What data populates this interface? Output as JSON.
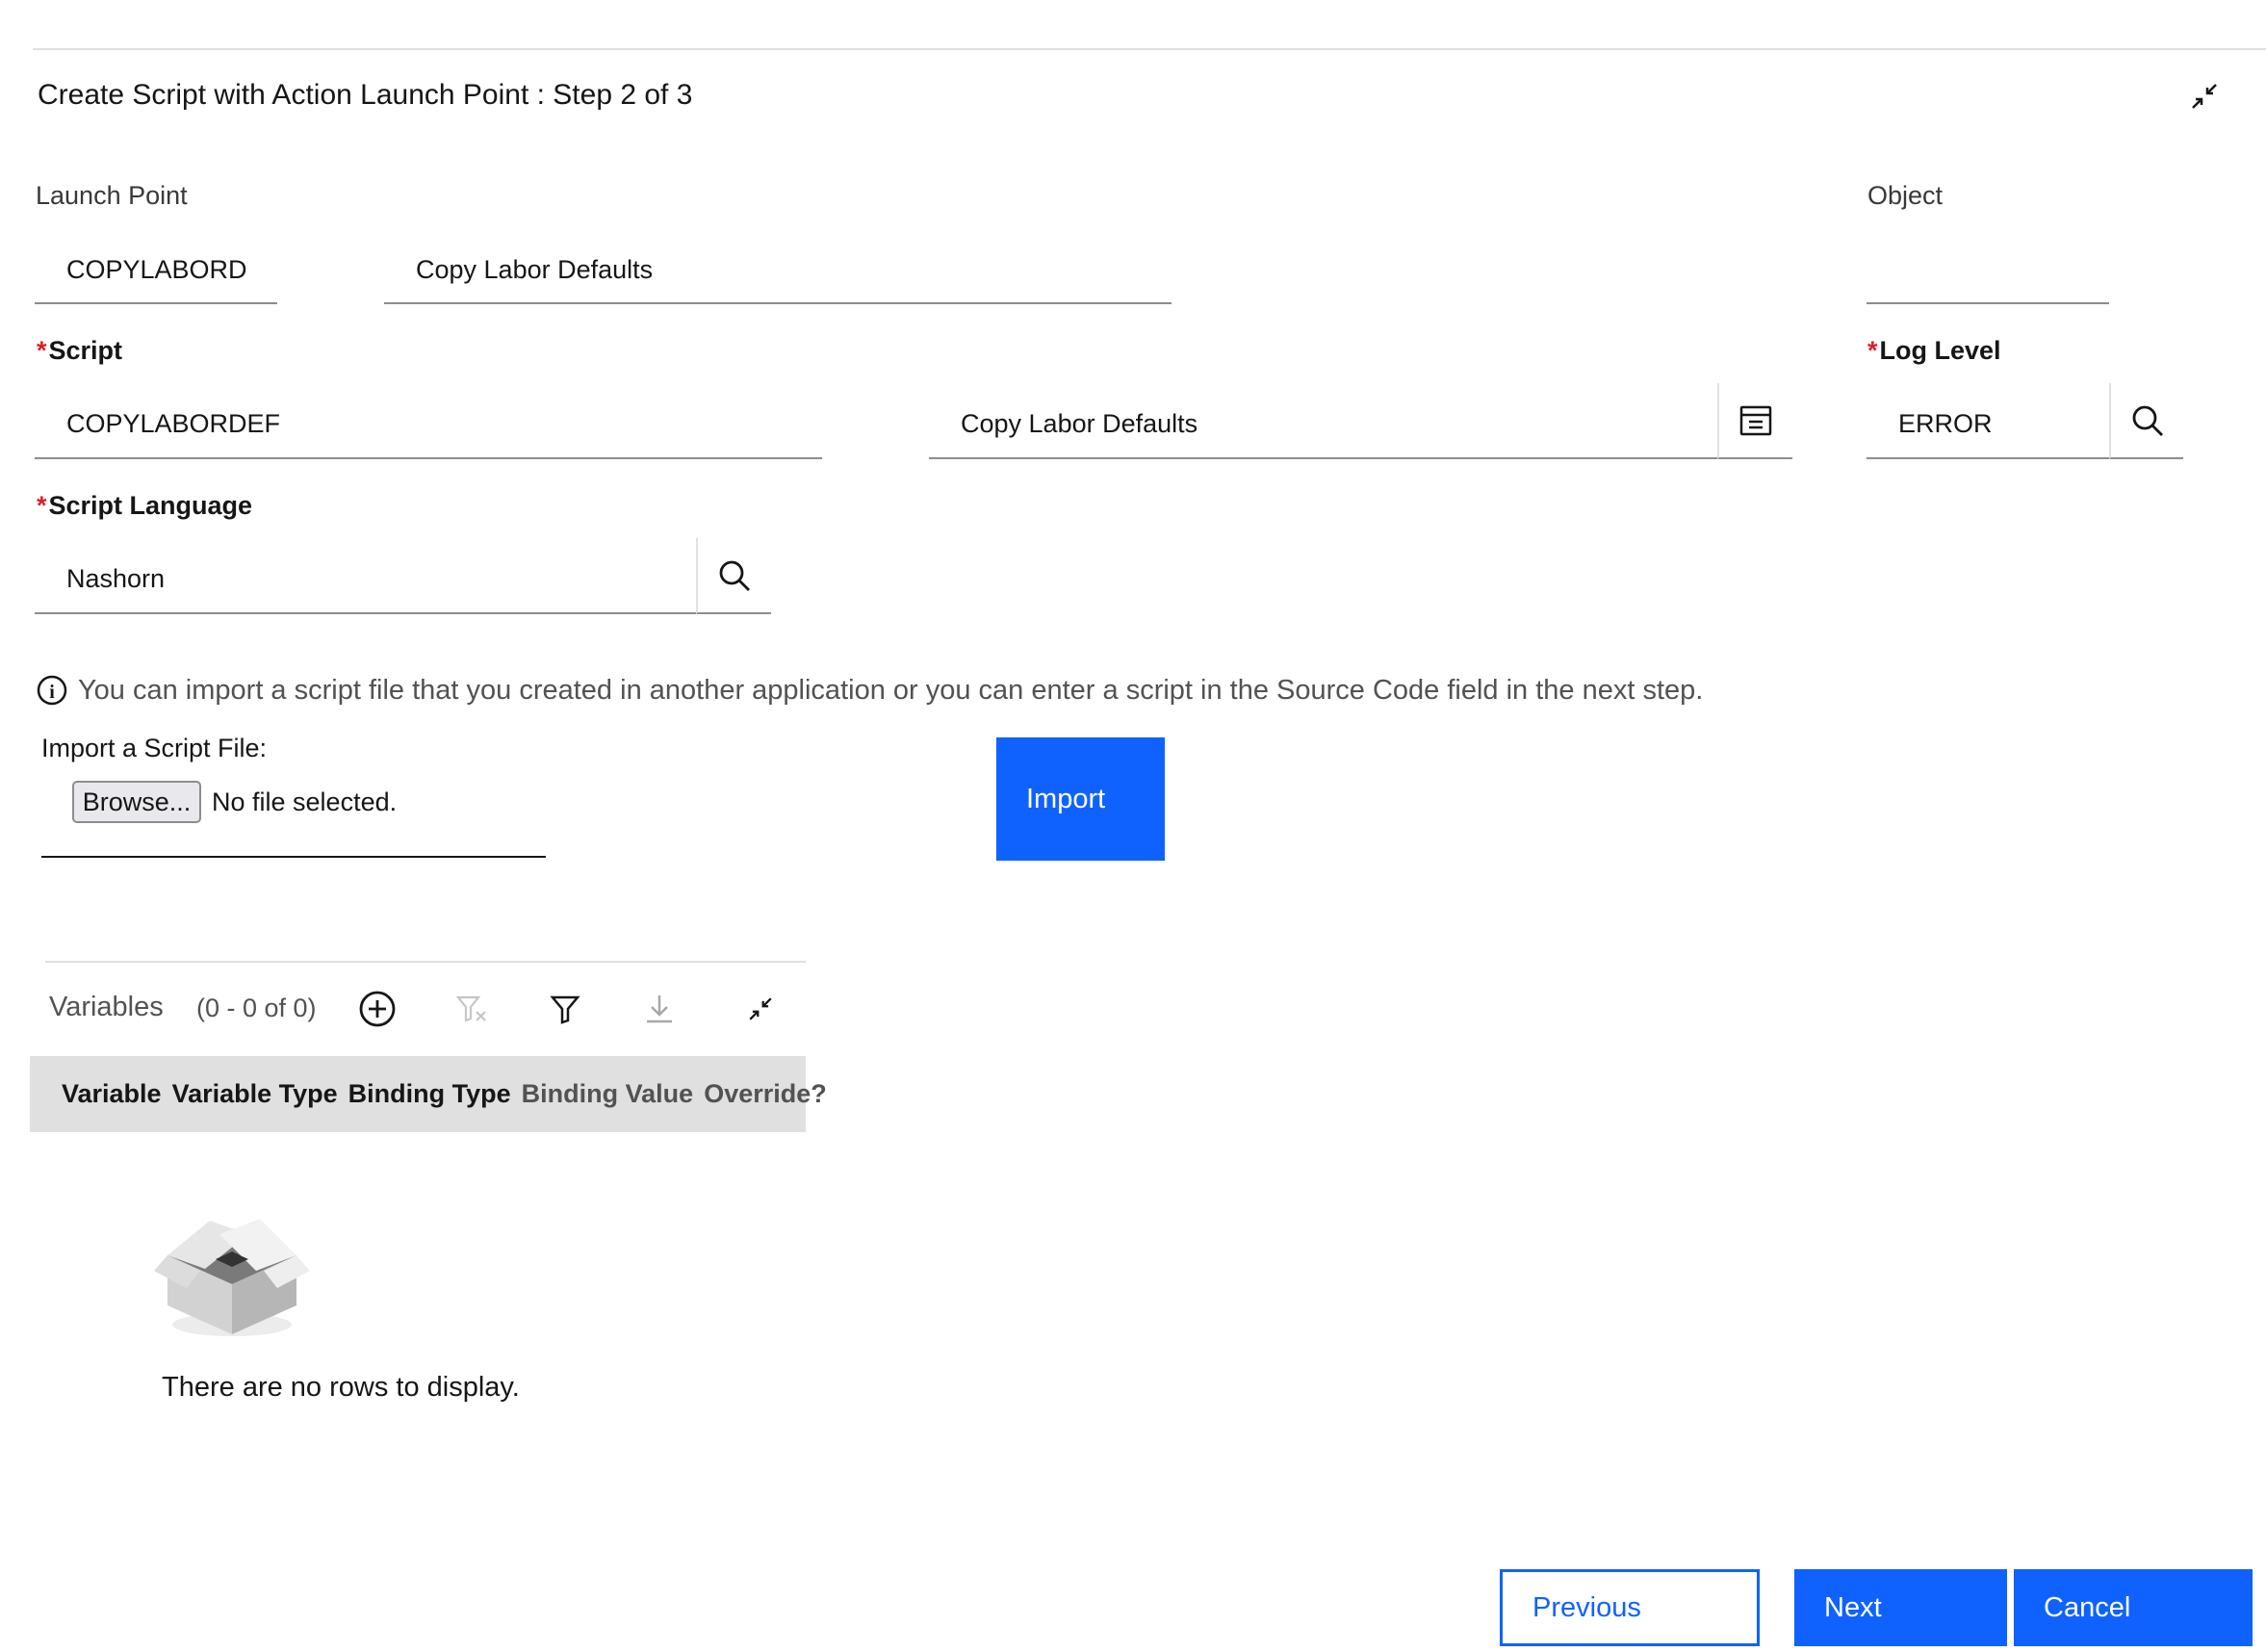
{
  "dialog": {
    "title": "Create Script with Action Launch Point : Step 2 of 3",
    "collapse_icon": "minimize-icon"
  },
  "launch_point": {
    "label": "Launch Point",
    "value": "COPYLABORDEF",
    "description": "Copy Labor Defaults"
  },
  "object": {
    "label": "Object",
    "value": ""
  },
  "script": {
    "label": "Script",
    "value": "COPYLABORDEF",
    "description": "Copy Labor Defaults",
    "detail_icon": "long-description-icon"
  },
  "log_level": {
    "label": "Log Level",
    "value": "ERROR",
    "lookup_icon": "search-icon"
  },
  "script_language": {
    "label": "Script Language",
    "value": "Nashorn",
    "lookup_icon": "search-icon"
  },
  "info": {
    "icon": "info-icon",
    "text": "You can import a script file that you created in another application or you can enter a script in the Source Code field in the next step."
  },
  "import": {
    "label": "Import a Script File:",
    "browse_label": "Browse...",
    "file_status": "No file selected.",
    "button_label": "Import"
  },
  "variables": {
    "title": "Variables",
    "count": "(0 - 0 of 0)",
    "toolbar_icons": [
      "add-icon",
      "clear-filter-icon",
      "filter-icon",
      "download-icon",
      "minimize-icon"
    ],
    "columns": [
      "Variable",
      "Variable Type",
      "Binding Type",
      "Binding Value",
      "Override?"
    ],
    "empty_message": "There are no rows to display.",
    "empty_icon": "empty-box-icon"
  },
  "footer": {
    "previous_label": "Previous",
    "next_label": "Next",
    "cancel_label": "Cancel"
  },
  "colors": {
    "primary": "#0f62fe",
    "required": "#da1e28",
    "header_bg": "#e0e0e0"
  }
}
